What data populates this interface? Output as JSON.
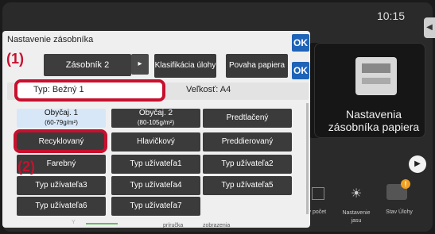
{
  "status": {
    "time": "10:15"
  },
  "background_panel": {
    "title": "Nastavenia zásobníka papiera"
  },
  "bottom_bar": {
    "counter_label": "vý počet",
    "brightness_label": "Nastavenie jasu",
    "job_status_label": "Stav Úlohy",
    "badge": "!",
    "guide_label": "príručka",
    "display_label": "zobrazenia",
    "y_label": "Y"
  },
  "dialog": {
    "title": "Nastavenie zásobníka",
    "ok_label": "OK",
    "tray_label": "Zásobník 2",
    "job_classification_label": "Klasifikácia úlohy",
    "paper_type_label": "Povaha papiera",
    "tab_ok_label": "OK",
    "type_text": "Typ:   Bežný 1",
    "size_text": "Veľkosť:  A4",
    "callouts": [
      "(1)",
      "(2)"
    ],
    "options": [
      {
        "line1": "Obyčaj. 1",
        "line2": "(60-79g/m²)"
      },
      {
        "line1": "Obyčaj. 2",
        "line2": "(80-105g/m²)"
      },
      {
        "line1": "Predtlačený",
        "line2": ""
      },
      {
        "line1": "Recyklovaný",
        "line2": ""
      },
      {
        "line1": "Hlavičkový",
        "line2": ""
      },
      {
        "line1": "Preddierovaný",
        "line2": ""
      },
      {
        "line1": "Farebný",
        "line2": ""
      },
      {
        "line1": "Typ užívateľa1",
        "line2": ""
      },
      {
        "line1": "Typ užívateľa2",
        "line2": ""
      },
      {
        "line1": "Typ užívateľa3",
        "line2": ""
      },
      {
        "line1": "Typ užívateľa4",
        "line2": ""
      },
      {
        "line1": "Typ užívateľa5",
        "line2": ""
      },
      {
        "line1": "Typ užívateľa6",
        "line2": ""
      },
      {
        "line1": "Typ užívateľa7",
        "line2": ""
      }
    ],
    "selected_option": 0,
    "highlighted_option": 3
  },
  "colors": {
    "accent_blue": "#1e63b8",
    "callout_red": "#c8102e",
    "selected_bg": "#d7e7f7"
  },
  "icons": [
    "chevron-right-icon",
    "printer-icon",
    "brightness-icon",
    "job-status-icon",
    "alert-badge-icon",
    "next-page-icon"
  ]
}
